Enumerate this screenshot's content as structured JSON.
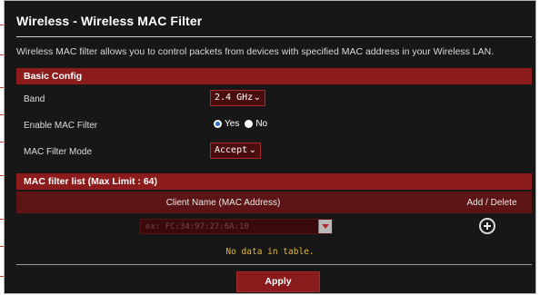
{
  "page": {
    "title": "Wireless - Wireless MAC Filter",
    "description": "Wireless MAC filter allows you to control packets from devices with specified MAC address in your Wireless LAN."
  },
  "basic_config": {
    "header": "Basic Config",
    "band": {
      "label": "Band",
      "value": "2.4 GHz"
    },
    "enable_mac_filter": {
      "label": "Enable MAC Filter",
      "options": [
        "Yes",
        "No"
      ],
      "selected": "Yes"
    },
    "mac_filter_mode": {
      "label": "MAC Filter Mode",
      "value": "Accept"
    }
  },
  "mac_filter_list": {
    "header": "MAC filter list (Max Limit : 64)",
    "columns": [
      "Client Name (MAC Address)",
      "Add / Delete"
    ],
    "input_placeholder": "ex: FC:34:97:27:6A:10",
    "empty_text": "No data in table."
  },
  "actions": {
    "apply_label": "Apply"
  },
  "colors": {
    "background": "#171717",
    "section_header": "#8c1c1c",
    "accent_red": "#a8292b",
    "empty_text": "#e5b62f",
    "radio_selected": "#1f6fd6"
  },
  "icons": {
    "select_chevron": "chevron-down-icon",
    "add_entry": "plus-circle-icon",
    "dropdown_arrow": "caret-down-icon"
  }
}
